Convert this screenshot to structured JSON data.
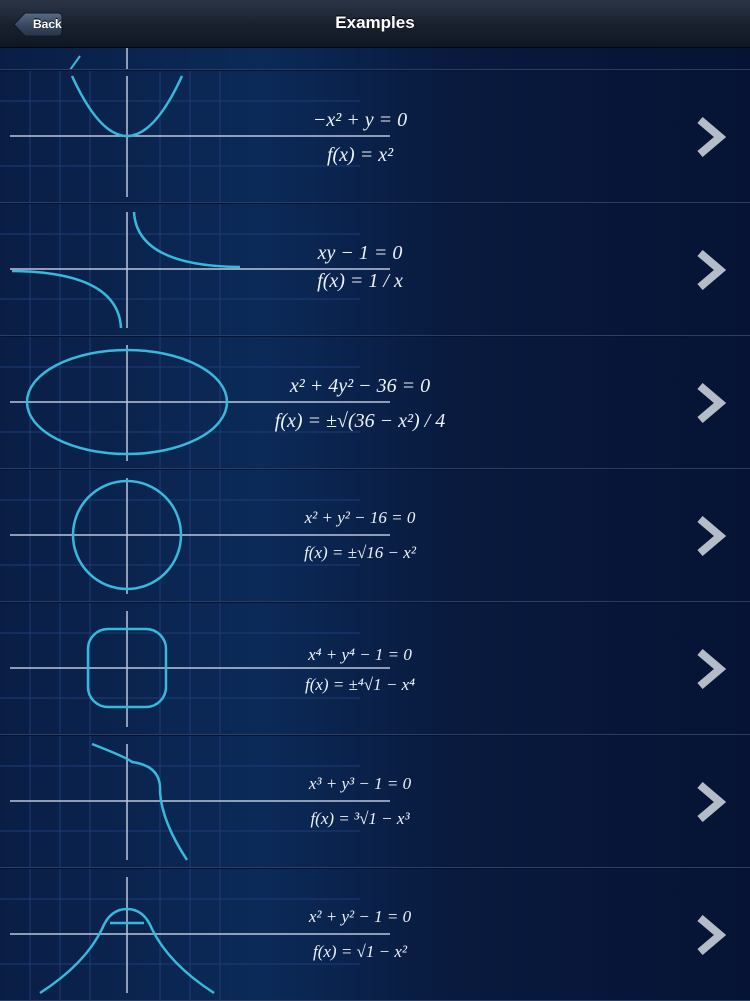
{
  "navbar": {
    "title": "Examples",
    "back_label": "Back"
  },
  "examples": [
    {
      "equation": "−x² + y = 0",
      "function": "f(x) = x²"
    },
    {
      "equation": "xy − 1 = 0",
      "function": "f(x) = 1 / x"
    },
    {
      "equation": "x² + 4y² − 36 = 0",
      "function": "f(x) = ±√(36 − x²) / 4"
    },
    {
      "equation": "x² + y² − 16 = 0",
      "function": "f(x) = ±√16 − x²"
    },
    {
      "equation": "x⁴ + y⁴ − 1 = 0",
      "function": "f(x) = ±⁴√1 − x⁴"
    },
    {
      "equation": "x³ + y³ − 1 = 0",
      "function": "f(x) = ³√1 − x³"
    },
    {
      "equation": "x² + y² − 1 = 0",
      "function": "f(x) = √1 − x²"
    }
  ],
  "colors": {
    "curve": "#37b9dc",
    "axis": "#b9c7dc",
    "grid": "#1d3c78",
    "chevron": "#b4bcc8"
  },
  "icons": {
    "row_disclosure": "chevron-right-icon",
    "back": "back-arrow-button-icon"
  }
}
